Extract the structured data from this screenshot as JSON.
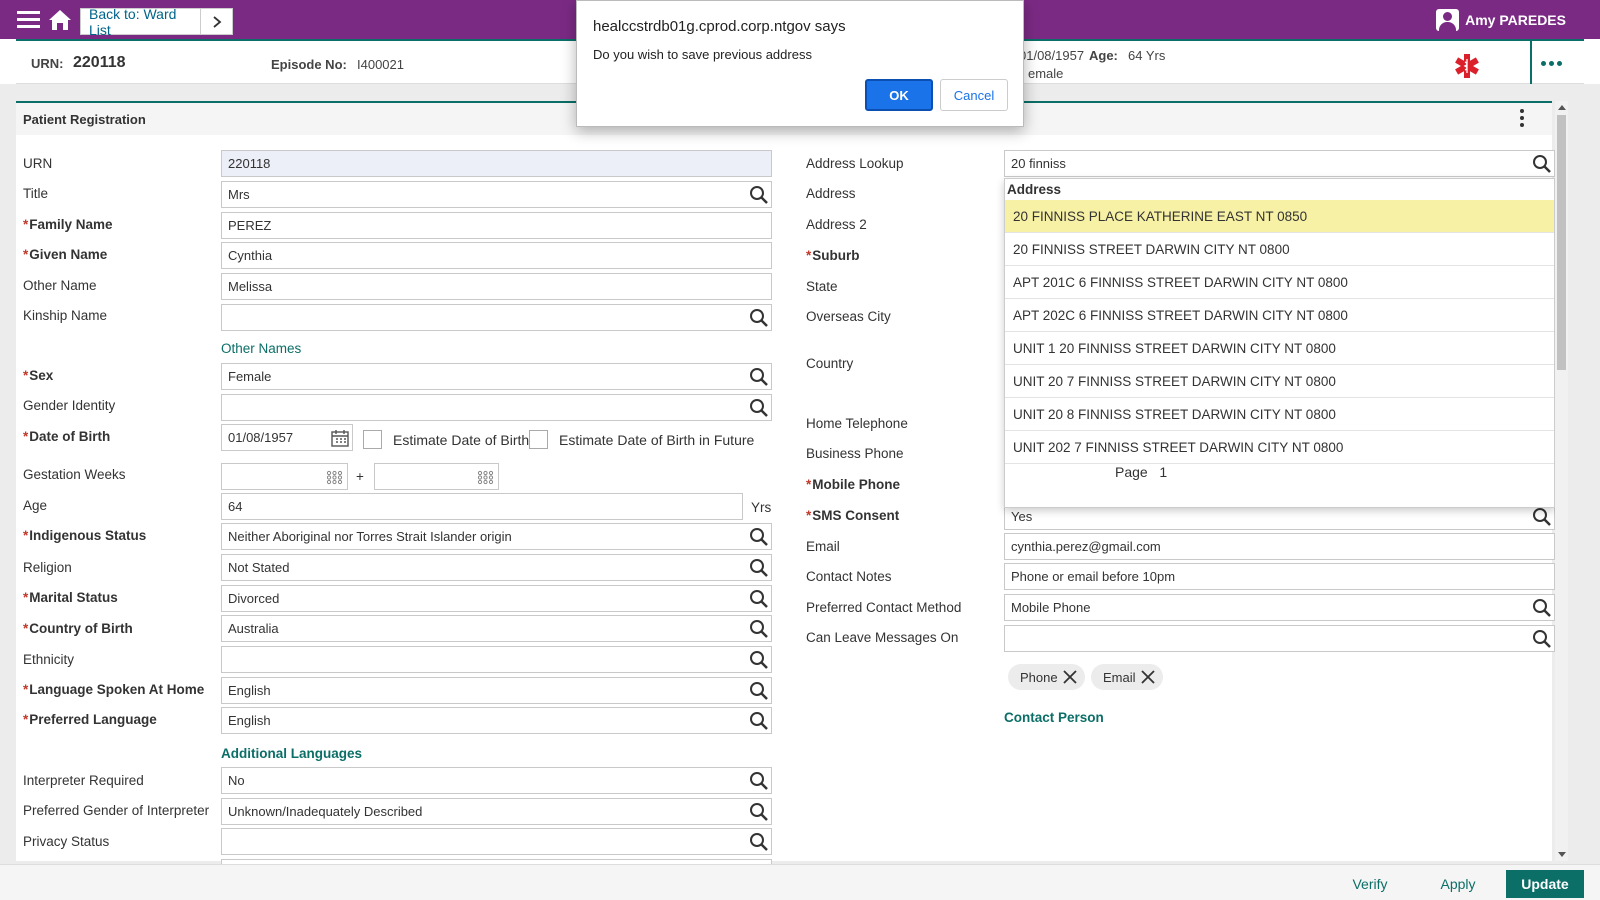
{
  "header": {
    "back_label": "Back to: Ward List",
    "user_name": "Amy PAREDES"
  },
  "banner": {
    "urn_label": "URN:",
    "urn_value": "220118",
    "episode_label": "Episode No:",
    "episode_value": "I400021",
    "dob_partial": "01/08/1957",
    "age_label": "Age:",
    "age_value": "64 Yrs",
    "sex_partial": "emale"
  },
  "panel": {
    "title": "Patient Registration"
  },
  "left_form": {
    "urn": {
      "label": "URN",
      "value": "220118"
    },
    "title": {
      "label": "Title",
      "value": "Mrs"
    },
    "family_name": {
      "label": "Family Name",
      "value": "PEREZ"
    },
    "given_name": {
      "label": "Given Name",
      "value": "Cynthia"
    },
    "other_name": {
      "label": "Other Name",
      "value": "Melissa"
    },
    "kinship_name": {
      "label": "Kinship Name",
      "value": ""
    },
    "other_names_link": "Other Names",
    "sex": {
      "label": "Sex",
      "value": "Female"
    },
    "gender_identity": {
      "label": "Gender Identity",
      "value": ""
    },
    "dob": {
      "label": "Date of Birth",
      "value": "01/08/1957"
    },
    "estimate_dob": "Estimate Date of Birth",
    "estimate_dob_future": "Estimate Date of Birth in Future",
    "gestation": {
      "label": "Gestation Weeks",
      "plus": "+"
    },
    "age": {
      "label": "Age",
      "value": "64",
      "unit": "Yrs"
    },
    "indigenous": {
      "label": "Indigenous Status",
      "value": "Neither Aboriginal nor Torres Strait Islander origin"
    },
    "religion": {
      "label": "Religion",
      "value": "Not Stated"
    },
    "marital": {
      "label": "Marital Status",
      "value": "Divorced"
    },
    "country_birth": {
      "label": "Country of Birth",
      "value": "Australia"
    },
    "ethnicity": {
      "label": "Ethnicity",
      "value": ""
    },
    "language_home": {
      "label": "Language Spoken At Home",
      "value": "English"
    },
    "preferred_language": {
      "label": "Preferred Language",
      "value": "English"
    },
    "additional_languages_link": "Additional Languages",
    "interpreter": {
      "label": "Interpreter Required",
      "value": "No"
    },
    "pref_gender_interp": {
      "label": "Preferred Gender of Interpreter",
      "value": "Unknown/Inadequately Described"
    },
    "privacy": {
      "label": "Privacy Status",
      "value": ""
    }
  },
  "right_form": {
    "address_lookup": {
      "label": "Address Lookup",
      "value": "20 finniss"
    },
    "address": {
      "label": "Address"
    },
    "address2": {
      "label": "Address 2"
    },
    "suburb": {
      "label": "Suburb"
    },
    "state": {
      "label": "State"
    },
    "overseas_city": {
      "label": "Overseas City"
    },
    "country": {
      "label": "Country"
    },
    "home_phone": {
      "label": "Home Telephone"
    },
    "business_phone": {
      "label": "Business Phone"
    },
    "mobile_phone": {
      "label": "Mobile Phone"
    },
    "sms_consent": {
      "label": "SMS Consent",
      "value": "Yes"
    },
    "email": {
      "label": "Email",
      "value": "cynthia.perez@gmail.com"
    },
    "contact_notes": {
      "label": "Contact Notes",
      "value": "Phone or email before 10pm"
    },
    "pref_contact": {
      "label": "Preferred Contact Method",
      "value": "Mobile Phone"
    },
    "leave_messages": {
      "label": "Can Leave Messages On",
      "value": ""
    },
    "chips": [
      "Phone",
      "Email"
    ],
    "contact_person_link": "Contact Person"
  },
  "dropdown": {
    "header": "Address",
    "items": [
      "20 FINNISS PLACE KATHERINE EAST NT 0850",
      "20 FINNISS STREET DARWIN CITY NT 0800",
      "APT 201C 6 FINNISS STREET DARWIN CITY NT 0800",
      "APT 202C 6 FINNISS STREET DARWIN CITY NT 0800",
      "UNIT 1 20 FINNISS STREET DARWIN CITY NT 0800",
      "UNIT 20 7 FINNISS STREET DARWIN CITY NT 0800",
      "UNIT 20 8 FINNISS STREET DARWIN CITY NT 0800",
      "UNIT 202 7 FINNISS STREET DARWIN CITY NT 0800"
    ],
    "page_label": "Page",
    "page_value": "1"
  },
  "footer": {
    "verify": "Verify",
    "apply": "Apply",
    "update": "Update"
  },
  "dialog": {
    "title": "healccstrdb01g.cprod.corp.ntgov says",
    "message": "Do you wish to save previous address",
    "ok": "OK",
    "cancel": "Cancel"
  },
  "colors": {
    "topbar": "#7b2a84",
    "accent": "#0b6e67",
    "selected_row": "#f7f1a5",
    "required": "#c0392b"
  }
}
